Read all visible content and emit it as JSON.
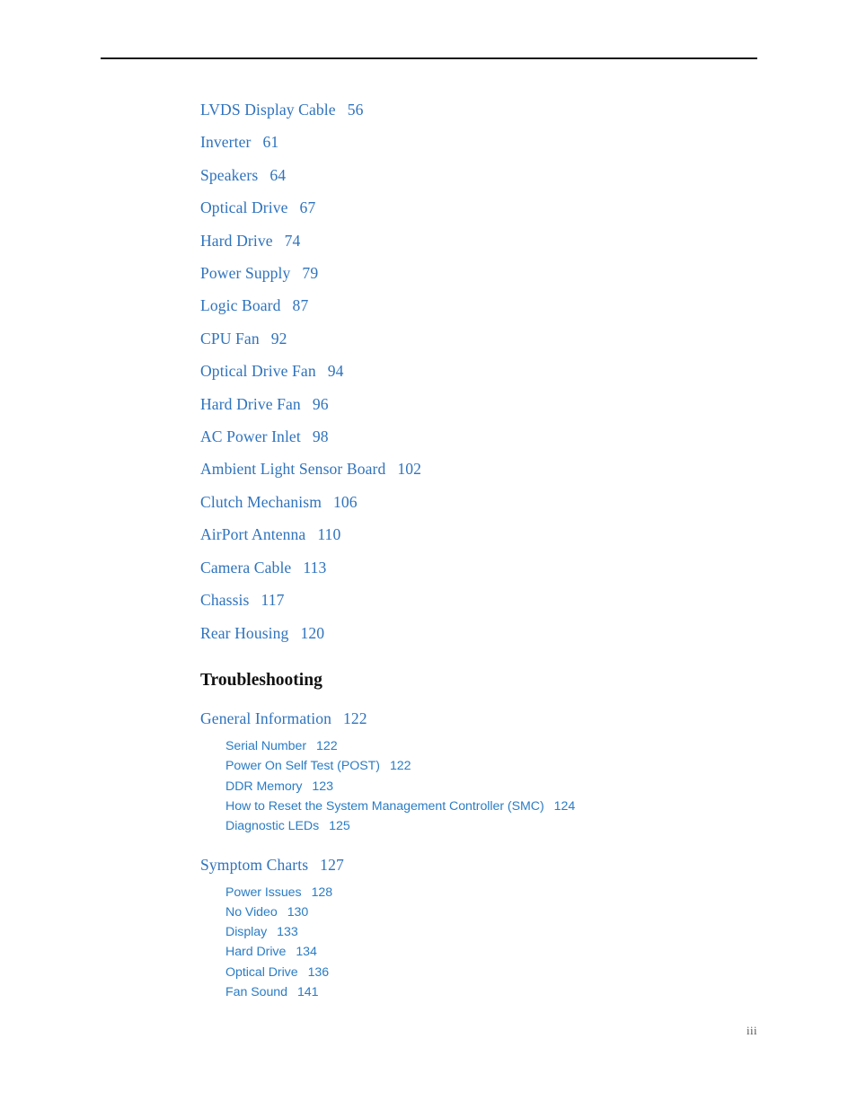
{
  "document": {
    "folio": "iii",
    "rule_color": "#1a1a1a",
    "link_color_level1": "#2f73bd",
    "link_color_level2": "#2b7cc4",
    "heading_color": "#111111"
  },
  "toc": {
    "top_entries": [
      {
        "label": "LVDS Display Cable",
        "page": "56"
      },
      {
        "label": "Inverter",
        "page": "61"
      },
      {
        "label": "Speakers",
        "page": "64"
      },
      {
        "label": "Optical Drive",
        "page": "67"
      },
      {
        "label": "Hard Drive",
        "page": "74"
      },
      {
        "label": "Power Supply",
        "page": "79"
      },
      {
        "label": "Logic Board",
        "page": "87"
      },
      {
        "label": "CPU Fan",
        "page": "92"
      },
      {
        "label": "Optical Drive Fan",
        "page": "94"
      },
      {
        "label": "Hard Drive Fan",
        "page": "96"
      },
      {
        "label": "AC Power Inlet",
        "page": "98"
      },
      {
        "label": "Ambient Light Sensor Board",
        "page": "102"
      },
      {
        "label": "Clutch Mechanism",
        "page": "106"
      },
      {
        "label": "AirPort Antenna",
        "page": "110"
      },
      {
        "label": "Camera Cable",
        "page": "113"
      },
      {
        "label": "Chassis",
        "page": "117"
      },
      {
        "label": "Rear Housing",
        "page": "120"
      }
    ],
    "section": {
      "heading": "Troubleshooting",
      "groups": [
        {
          "label": "General Information",
          "page": "122",
          "children": [
            {
              "label": "Serial Number",
              "page": "122"
            },
            {
              "label": "Power On Self Test (POST)",
              "page": "122"
            },
            {
              "label": "DDR Memory",
              "page": "123"
            },
            {
              "label": "How to Reset the System Management Controller (SMC)",
              "page": "124"
            },
            {
              "label": "Diagnostic LEDs",
              "page": "125"
            }
          ]
        },
        {
          "label": "Symptom Charts",
          "page": "127",
          "children": [
            {
              "label": "Power Issues",
              "page": "128"
            },
            {
              "label": "No Video",
              "page": "130"
            },
            {
              "label": "Display",
              "page": "133"
            },
            {
              "label": "Hard Drive",
              "page": "134"
            },
            {
              "label": "Optical Drive",
              "page": "136"
            },
            {
              "label": "Fan Sound",
              "page": "141"
            }
          ]
        }
      ]
    }
  }
}
